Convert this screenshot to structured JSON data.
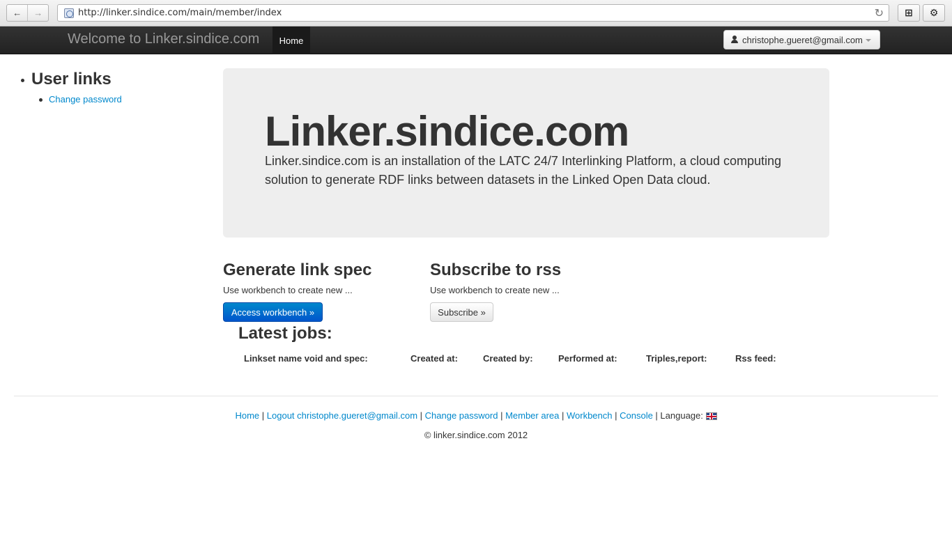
{
  "browser": {
    "url": "http://linker.sindice.com/main/member/index",
    "back_icon": "←",
    "forward_icon": "→",
    "reload_icon": "↻",
    "new_tab_icon": "⊞",
    "settings_icon": "⚙"
  },
  "navbar": {
    "brand": "Welcome to Linker.sindice.com",
    "home": "Home",
    "user_email": "christophe.gueret@gmail.com"
  },
  "sidebar": {
    "title": "User links",
    "items": [
      {
        "label": "Change password"
      }
    ]
  },
  "hero": {
    "title": "Linker.sindice.com",
    "text": "Linker.sindice.com is an installation of the LATC 24/7 Interlinking Platform, a cloud computing solution to generate RDF links between datasets in the Linked Open Data cloud."
  },
  "columns": [
    {
      "title": "Generate link spec",
      "text": "Use workbench to create new ...",
      "button": "Access workbench »"
    },
    {
      "title": "Subscribe to rss",
      "text": "Use workbench to create new ...",
      "button": "Subscribe »"
    }
  ],
  "jobs": {
    "title": "Latest jobs:",
    "headers": [
      "Linkset name void and spec:",
      "Created at:",
      "Created by:",
      "Performed at:",
      "Triples,report:",
      "Rss feed:"
    ]
  },
  "footer": {
    "links": [
      "Home",
      "Logout christophe.gueret@gmail.com",
      "Change password",
      "Member area",
      "Workbench",
      "Console"
    ],
    "separator": " | ",
    "language_label": "Language:",
    "copyright": "© linker.sindice.com 2012"
  }
}
